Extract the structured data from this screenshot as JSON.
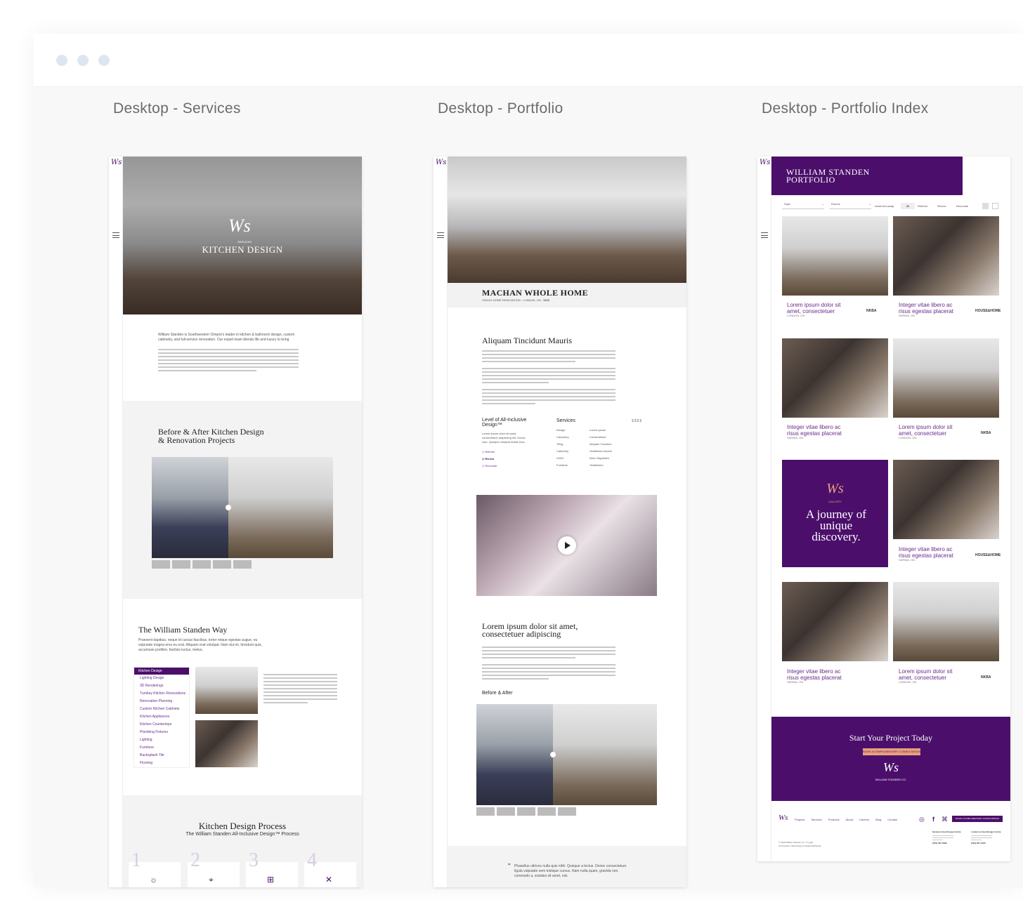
{
  "window": {
    "dots": [
      "dot-1",
      "dot-2",
      "dot-3"
    ]
  },
  "artboards": {
    "services_label": "Desktop - Services",
    "portfolio_label": "Desktop - Portfolio",
    "index_label": "Desktop - Portfolio Index"
  },
  "services": {
    "hero_eyebrow": "SERVICES",
    "hero_title": "KITCHEN DESIGN",
    "intro": "William Standen is Southwestern Ontario's leader in kitchen & bathroom design, custom cabinetry, and full-service renovation. Our expert team blends life and luxury to bring",
    "section_before_after": "Before & After Kitchen Design\n& Renovation Projects",
    "way_title": "The William Standen Way",
    "way_text": "Praesent dapibus, neque id cursus faucibus, tortor neque egestas augue, eu vulputate magna eros eu erat. Aliquam erat volutpat. Nam dui mi, tincidunt quis, accumsan porttitor, facilisis luctus, metus.",
    "menu": [
      "Kitchen Design",
      "Lighting Design",
      "3D Renderings",
      "Turnkey Kitchen Renovations",
      "Renovation Planning",
      "Custom Kitchen Cabinets",
      "Kitchen Appliances",
      "Kitchen Countertops",
      "Plumbing Fixtures",
      "Lighting",
      "Furniture",
      "Backsplash Tile",
      "Flooring"
    ],
    "process_title": "Kitchen Design Process",
    "process_subtitle": "The William Standen All-Inclusive Design™ Process",
    "process_steps": [
      "1",
      "2",
      "3",
      "4"
    ]
  },
  "portfolio": {
    "title": "MACHAN WHOLE HOME",
    "meta": "SINGLE HOME RENOVATION  ·  LONDON, ON  ·  $$$$",
    "h2": "Aliquam Tincidunt Mauris",
    "level_title": "Level of All-Inclusive Design™",
    "level_text": "Lorem ipsum dolor sit amet, consectetuer adipiscing elit. Donec odio. Quisque volutpat mattis eros.",
    "levels": [
      "Refresh",
      "Renew",
      "Renovate"
    ],
    "services_title": "Services",
    "price": "$$$$",
    "services_col1": [
      "Design",
      "Carpentry",
      "Tiling",
      "Cabinetry",
      "HVAC",
      "Furniture"
    ],
    "services_col2": [
      "Lorem ipsum",
      "Consectetuer",
      "Aliquam Tincidunt",
      "Vestibulum Auctor",
      "Nunc Dignissim",
      "Vestibulum"
    ],
    "h2b": "Lorem ipsum dolor sit amet, consectetuer adipiscing",
    "before_after": "Before & After",
    "quote": "Phasellus ultrices nulla quis nibh. Quisque a lectus. Donec consectetuer ligula vulputate sem tristique cursus. Nam nulla quam, gravida non, commodo a, sodales sit amet, nisi."
  },
  "index": {
    "title": "WILLIAM STANDEN\nPORTFOLIO",
    "filters": [
      "Style",
      "Rooms"
    ],
    "level_label": "Level of Luxury",
    "level_opts": [
      "All",
      "Refresh",
      "Renew",
      "Renovate"
    ],
    "cards": [
      {
        "title": "Lorem ipsum dolor sit amet, consectetuer",
        "loc": "LONDON, ON",
        "badge": "NKBA"
      },
      {
        "title": "Integer vitae libero ac risus egestas placerat",
        "loc": "SARNIA, ON",
        "badge": "HOUSE&HOME"
      },
      {
        "title": "Integer vitae libero ac risus egestas placerat",
        "loc": "SARNIA, ON",
        "badge": ""
      },
      {
        "title": "Lorem ipsum dolor sit amet, consectetuer",
        "loc": "LONDON, ON",
        "badge": "NKBA"
      },
      {
        "title": "Integer vitae libero ac risus egestas placerat",
        "loc": "SARNIA, ON",
        "badge": "HOUSE&HOME"
      },
      {
        "title": "Integer vitae libero ac risus egestas placerat",
        "loc": "SARNIA, ON",
        "badge": ""
      },
      {
        "title": "Lorem ipsum dolor sit amet, consectetuer",
        "loc": "LONDON, ON",
        "badge": "NKBA"
      }
    ],
    "promo_eyebrow": "GALLERY",
    "promo_quote": "A journey of unique discovery.",
    "cta_title": "Start Your Project Today",
    "cta_button": "BOOK A COMPLIMENTARY CONSULTATION",
    "cta_brand": "WILLIAM STANDEN CO.",
    "footer_links": [
      "Projects",
      "Services",
      "Products",
      "About",
      "Careers",
      "Blog",
      "Contact"
    ],
    "footer_button": "BOOK A COMPLIMENTARY CONSULTATION",
    "footer_copy": "© 2019 William Standen Co.™ Legal\nAd Creative | Web Design & Digital Marketing",
    "loc1_title": "Sarnia & Area Design Centre",
    "loc1_phone": "(519) 337-7999",
    "loc2_title": "London & Area Design Centre",
    "loc2_phone": "(519) 657-1465"
  },
  "colors": {
    "brand": "#4b0f6b",
    "accent": "#e8a07c"
  }
}
